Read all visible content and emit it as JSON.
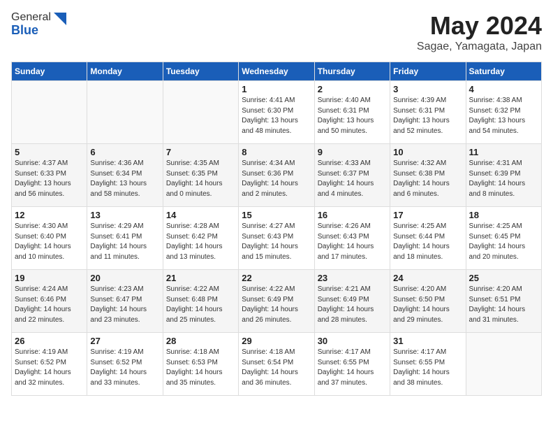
{
  "header": {
    "logo_line1": "General",
    "logo_line2": "Blue",
    "month": "May 2024",
    "location": "Sagae, Yamagata, Japan"
  },
  "days_of_week": [
    "Sunday",
    "Monday",
    "Tuesday",
    "Wednesday",
    "Thursday",
    "Friday",
    "Saturday"
  ],
  "weeks": [
    [
      {
        "day": "",
        "info": ""
      },
      {
        "day": "",
        "info": ""
      },
      {
        "day": "",
        "info": ""
      },
      {
        "day": "1",
        "info": "Sunrise: 4:41 AM\nSunset: 6:30 PM\nDaylight: 13 hours\nand 48 minutes."
      },
      {
        "day": "2",
        "info": "Sunrise: 4:40 AM\nSunset: 6:31 PM\nDaylight: 13 hours\nand 50 minutes."
      },
      {
        "day": "3",
        "info": "Sunrise: 4:39 AM\nSunset: 6:31 PM\nDaylight: 13 hours\nand 52 minutes."
      },
      {
        "day": "4",
        "info": "Sunrise: 4:38 AM\nSunset: 6:32 PM\nDaylight: 13 hours\nand 54 minutes."
      }
    ],
    [
      {
        "day": "5",
        "info": "Sunrise: 4:37 AM\nSunset: 6:33 PM\nDaylight: 13 hours\nand 56 minutes."
      },
      {
        "day": "6",
        "info": "Sunrise: 4:36 AM\nSunset: 6:34 PM\nDaylight: 13 hours\nand 58 minutes."
      },
      {
        "day": "7",
        "info": "Sunrise: 4:35 AM\nSunset: 6:35 PM\nDaylight: 14 hours\nand 0 minutes."
      },
      {
        "day": "8",
        "info": "Sunrise: 4:34 AM\nSunset: 6:36 PM\nDaylight: 14 hours\nand 2 minutes."
      },
      {
        "day": "9",
        "info": "Sunrise: 4:33 AM\nSunset: 6:37 PM\nDaylight: 14 hours\nand 4 minutes."
      },
      {
        "day": "10",
        "info": "Sunrise: 4:32 AM\nSunset: 6:38 PM\nDaylight: 14 hours\nand 6 minutes."
      },
      {
        "day": "11",
        "info": "Sunrise: 4:31 AM\nSunset: 6:39 PM\nDaylight: 14 hours\nand 8 minutes."
      }
    ],
    [
      {
        "day": "12",
        "info": "Sunrise: 4:30 AM\nSunset: 6:40 PM\nDaylight: 14 hours\nand 10 minutes."
      },
      {
        "day": "13",
        "info": "Sunrise: 4:29 AM\nSunset: 6:41 PM\nDaylight: 14 hours\nand 11 minutes."
      },
      {
        "day": "14",
        "info": "Sunrise: 4:28 AM\nSunset: 6:42 PM\nDaylight: 14 hours\nand 13 minutes."
      },
      {
        "day": "15",
        "info": "Sunrise: 4:27 AM\nSunset: 6:43 PM\nDaylight: 14 hours\nand 15 minutes."
      },
      {
        "day": "16",
        "info": "Sunrise: 4:26 AM\nSunset: 6:43 PM\nDaylight: 14 hours\nand 17 minutes."
      },
      {
        "day": "17",
        "info": "Sunrise: 4:25 AM\nSunset: 6:44 PM\nDaylight: 14 hours\nand 18 minutes."
      },
      {
        "day": "18",
        "info": "Sunrise: 4:25 AM\nSunset: 6:45 PM\nDaylight: 14 hours\nand 20 minutes."
      }
    ],
    [
      {
        "day": "19",
        "info": "Sunrise: 4:24 AM\nSunset: 6:46 PM\nDaylight: 14 hours\nand 22 minutes."
      },
      {
        "day": "20",
        "info": "Sunrise: 4:23 AM\nSunset: 6:47 PM\nDaylight: 14 hours\nand 23 minutes."
      },
      {
        "day": "21",
        "info": "Sunrise: 4:22 AM\nSunset: 6:48 PM\nDaylight: 14 hours\nand 25 minutes."
      },
      {
        "day": "22",
        "info": "Sunrise: 4:22 AM\nSunset: 6:49 PM\nDaylight: 14 hours\nand 26 minutes."
      },
      {
        "day": "23",
        "info": "Sunrise: 4:21 AM\nSunset: 6:49 PM\nDaylight: 14 hours\nand 28 minutes."
      },
      {
        "day": "24",
        "info": "Sunrise: 4:20 AM\nSunset: 6:50 PM\nDaylight: 14 hours\nand 29 minutes."
      },
      {
        "day": "25",
        "info": "Sunrise: 4:20 AM\nSunset: 6:51 PM\nDaylight: 14 hours\nand 31 minutes."
      }
    ],
    [
      {
        "day": "26",
        "info": "Sunrise: 4:19 AM\nSunset: 6:52 PM\nDaylight: 14 hours\nand 32 minutes."
      },
      {
        "day": "27",
        "info": "Sunrise: 4:19 AM\nSunset: 6:52 PM\nDaylight: 14 hours\nand 33 minutes."
      },
      {
        "day": "28",
        "info": "Sunrise: 4:18 AM\nSunset: 6:53 PM\nDaylight: 14 hours\nand 35 minutes."
      },
      {
        "day": "29",
        "info": "Sunrise: 4:18 AM\nSunset: 6:54 PM\nDaylight: 14 hours\nand 36 minutes."
      },
      {
        "day": "30",
        "info": "Sunrise: 4:17 AM\nSunset: 6:55 PM\nDaylight: 14 hours\nand 37 minutes."
      },
      {
        "day": "31",
        "info": "Sunrise: 4:17 AM\nSunset: 6:55 PM\nDaylight: 14 hours\nand 38 minutes."
      },
      {
        "day": "",
        "info": ""
      }
    ]
  ]
}
